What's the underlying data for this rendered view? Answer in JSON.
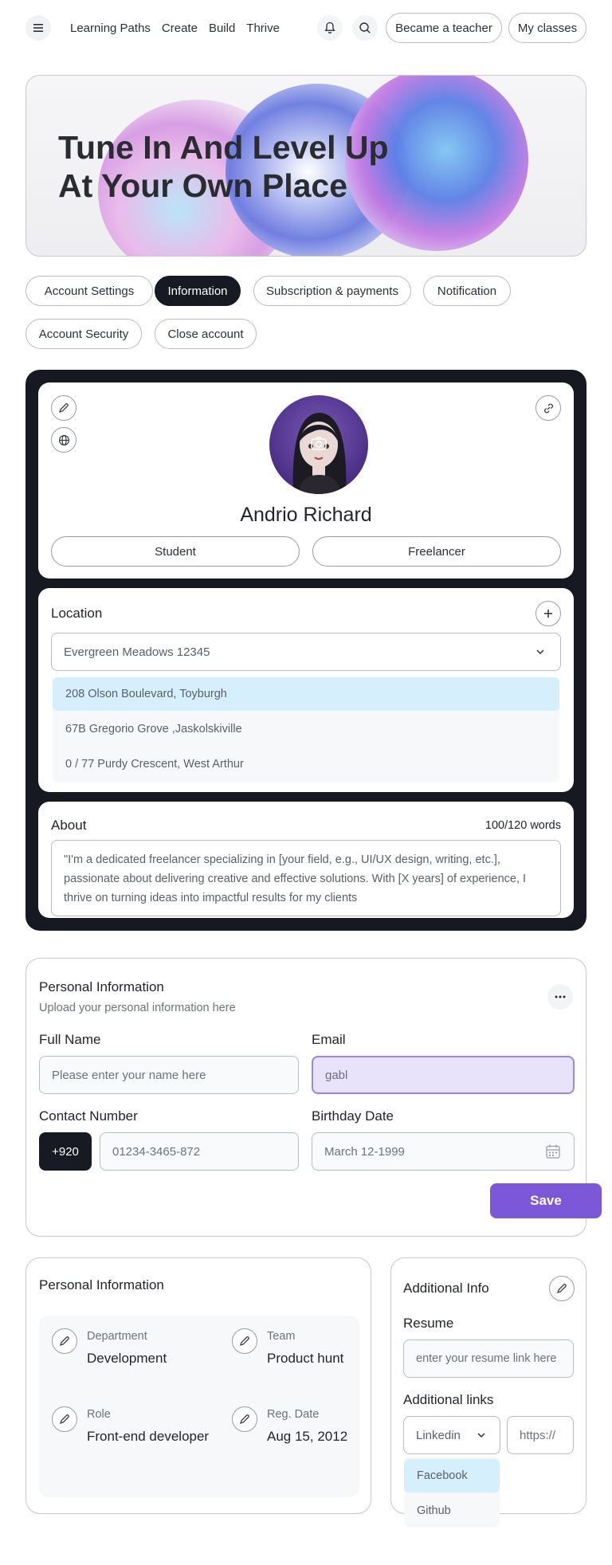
{
  "nav": {
    "links": [
      "Learning Paths",
      "Create",
      "Build",
      "Thrive"
    ],
    "became_teacher": "Became a teacher",
    "my_classes": "My classes"
  },
  "hero": {
    "line1": "Tune In And Level Up",
    "line2": "At Your Own Place"
  },
  "tabs": [
    "Account Settings",
    "Information",
    "Subscription & payments",
    "Notification",
    "Account Security",
    "Close account"
  ],
  "active_tab": "Information",
  "profile": {
    "name": "Andrio Richard",
    "roles": [
      "Student",
      "Freelancer"
    ]
  },
  "location": {
    "title": "Location",
    "selected": "Evergreen Meadows 12345",
    "options": [
      "208 Olson Boulevard, Toyburgh",
      "67B Gregorio Grove ,Jaskolskiville",
      "0 / 77 Purdy Crescent, West Arthur"
    ]
  },
  "about": {
    "title": "About",
    "count": "100/120 words",
    "line1": "\"I'm a dedicated freelancer specializing in [your field, e.g., UI/UX design, writing, etc.],",
    "line2": "passionate about delivering creative and effective solutions. With [X years] of experience, I",
    "line3": "thrive on turning ideas into impactful results for my clients"
  },
  "personal_form": {
    "title": "Personal Information",
    "subtitle": "Upload your personal information here",
    "full_name_label": "Full Name",
    "full_name_placeholder": "Please enter your name here",
    "email_label": "Email",
    "email_value": "gabl",
    "contact_label": "Contact Number",
    "country_code": "+920",
    "phone_placeholder": "01234-3465-872",
    "birthday_label": "Birthday Date",
    "birthday_value": "March 12-1999",
    "save": "Save"
  },
  "personal_info": {
    "title": "Personal Information",
    "items": [
      {
        "label": "Department",
        "value": "Development"
      },
      {
        "label": "Team",
        "value": "Product hunt"
      },
      {
        "label": "Role",
        "value": "Front-end developer"
      },
      {
        "label": "Reg. Date",
        "value": "Aug 15, 2012"
      }
    ]
  },
  "additional": {
    "title": "Additional Info",
    "resume_label": "Resume",
    "resume_placeholder": "enter your resume link here",
    "links_label": "Additional links",
    "link_type": "Linkedin",
    "link_placeholder": "https://",
    "link_options": [
      "Facebook",
      "Github"
    ]
  },
  "colors": {
    "accent": "#7c57d8",
    "dark": "#161922",
    "highlight": "#d6effc"
  }
}
